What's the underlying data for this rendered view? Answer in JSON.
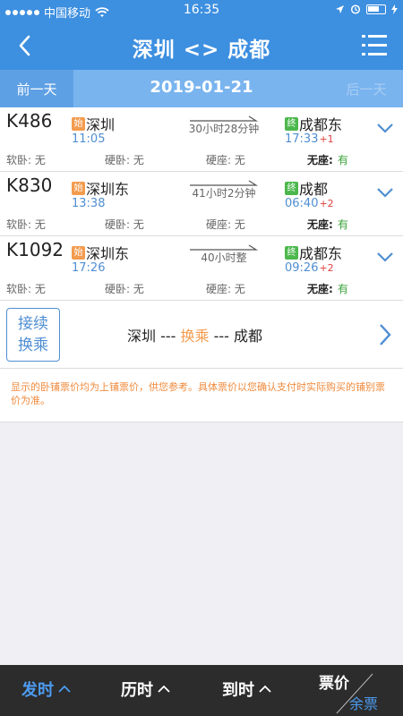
{
  "status_bar": {
    "carrier": "中国移动",
    "time": "16:35"
  },
  "header": {
    "title": "深圳 <> 成都"
  },
  "date_bar": {
    "prev_label": "前一天",
    "date": "2019-01-21",
    "next_label": "后一天"
  },
  "trains": [
    {
      "number": "K486",
      "dep_station": "深圳",
      "dep_badge": "始",
      "dep_time": "11:05",
      "duration": "30小时28分钟",
      "arr_station": "成都东",
      "arr_badge": "终",
      "arr_time": "17:33",
      "arr_plus": "+1",
      "seats": {
        "soft_sleeper": "软卧: 无",
        "hard_sleeper": "硬卧: 无",
        "hard_seat": "硬座: 无",
        "no_seat_label": "无座:",
        "no_seat_value": "有"
      }
    },
    {
      "number": "K830",
      "dep_station": "深圳东",
      "dep_badge": "始",
      "dep_time": "13:38",
      "duration": "41小时2分钟",
      "arr_station": "成都",
      "arr_badge": "终",
      "arr_time": "06:40",
      "arr_plus": "+2",
      "seats": {
        "soft_sleeper": "软卧: 无",
        "hard_sleeper": "硬卧: 无",
        "hard_seat": "硬座: 无",
        "no_seat_label": "无座:",
        "no_seat_value": "有"
      }
    },
    {
      "number": "K1092",
      "dep_station": "深圳东",
      "dep_badge": "始",
      "dep_time": "17:26",
      "duration": "40小时整",
      "arr_station": "成都东",
      "arr_badge": "终",
      "arr_time": "09:26",
      "arr_plus": "+2",
      "seats": {
        "soft_sleeper": "软卧: 无",
        "hard_sleeper": "硬卧: 无",
        "hard_seat": "硬座: 无",
        "no_seat_label": "无座:",
        "no_seat_value": "有"
      }
    }
  ],
  "transfer": {
    "button_line1": "接续",
    "button_line2": "换乘",
    "from": "深圳",
    "sep1": " --- ",
    "mid": "换乘",
    "sep2": " --- ",
    "to": "成都"
  },
  "notice": "显示的卧铺票价均为上铺票价，供您参考。具体票价以您确认支付时实际购买的铺别票价为准。",
  "bottom_bar": {
    "depart_label": "发时",
    "duration_label": "历时",
    "arrive_label": "到时",
    "price_label": "票价",
    "remaining_label": "余票"
  },
  "colors": {
    "primary": "#3d8fe0",
    "accent_orange": "#f39b4e",
    "accent_green": "#4cb84c",
    "available": "#3aa33a",
    "day_plus": "#e04040"
  }
}
